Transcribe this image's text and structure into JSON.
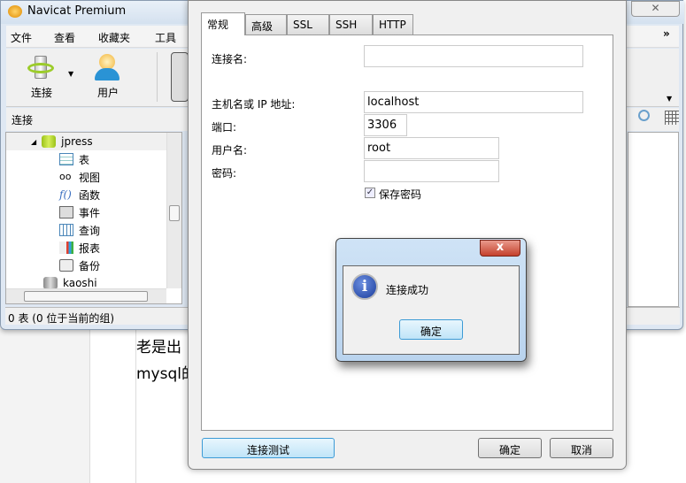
{
  "background": {
    "lines": [
      "老是出",
      "mysql的"
    ]
  },
  "navicat": {
    "title": "Navicat Premium",
    "menu": [
      "文件",
      "查看",
      "收藏夹",
      "工具"
    ],
    "toolbar": [
      {
        "label": "连接",
        "icon": "connect-icon"
      },
      {
        "label": "用户",
        "icon": "user-icon"
      }
    ],
    "connections_header": "连接",
    "tree": [
      {
        "label": "jpress",
        "icon": "database-icon",
        "expanded": true
      },
      {
        "label": "表",
        "icon": "table-icon"
      },
      {
        "label": "视图",
        "icon": "view-icon"
      },
      {
        "label": "函数",
        "icon": "function-icon"
      },
      {
        "label": "事件",
        "icon": "event-icon"
      },
      {
        "label": "查询",
        "icon": "query-icon"
      },
      {
        "label": "报表",
        "icon": "report-icon"
      },
      {
        "label": "备份",
        "icon": "backup-icon"
      },
      {
        "label": "kaoshi",
        "icon": "database-icon"
      }
    ],
    "status": "0 表 (0 位于当前的组)",
    "more": "»"
  },
  "dialog": {
    "tabs": [
      "常规",
      "高级",
      "SSL",
      "SSH",
      "HTTP"
    ],
    "active_tab": "常规",
    "fields": {
      "connection_name": {
        "label": "连接名:",
        "value": ""
      },
      "host": {
        "label": "主机名或 IP 地址:",
        "value": "localhost"
      },
      "port": {
        "label": "端口:",
        "value": "3306"
      },
      "username": {
        "label": "用户名:",
        "value": "root"
      },
      "password": {
        "label": "密码:",
        "value": ""
      }
    },
    "save_password": {
      "label": "保存密码",
      "checked": true
    },
    "test_button": "连接测试",
    "ok_button": "确定",
    "cancel_button": "取消"
  },
  "message_box": {
    "close": "x",
    "text": "连接成功",
    "ok_button": "确定",
    "icon": "info-icon"
  }
}
